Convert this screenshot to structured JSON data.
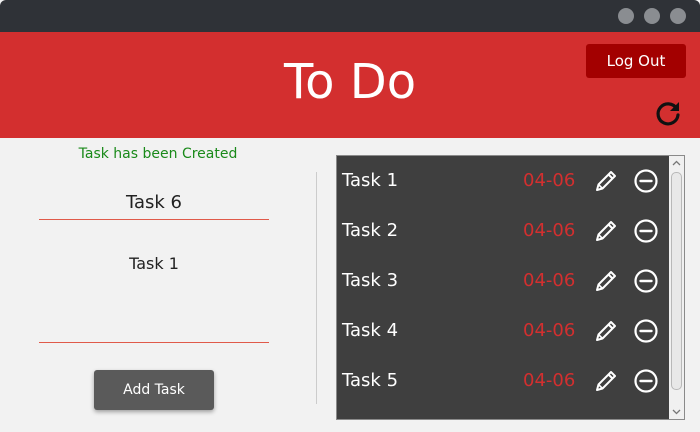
{
  "app": {
    "title": "To Do",
    "logout_label": "Log Out",
    "accent_color": "#d32f2f"
  },
  "form": {
    "status_message": "Task has been Created",
    "task_title_value": "Task 6",
    "task_description_value": "Task 1",
    "add_button_label": "Add Task"
  },
  "tasks": [
    {
      "name": "Task 1",
      "date": "04-06"
    },
    {
      "name": "Task 2",
      "date": "04-06"
    },
    {
      "name": "Task 3",
      "date": "04-06"
    },
    {
      "name": "Task 4",
      "date": "04-06"
    },
    {
      "name": "Task 5",
      "date": "04-06"
    }
  ],
  "icons": {
    "refresh": "refresh-icon",
    "edit": "pencil-icon",
    "remove": "minus-circle-icon"
  }
}
